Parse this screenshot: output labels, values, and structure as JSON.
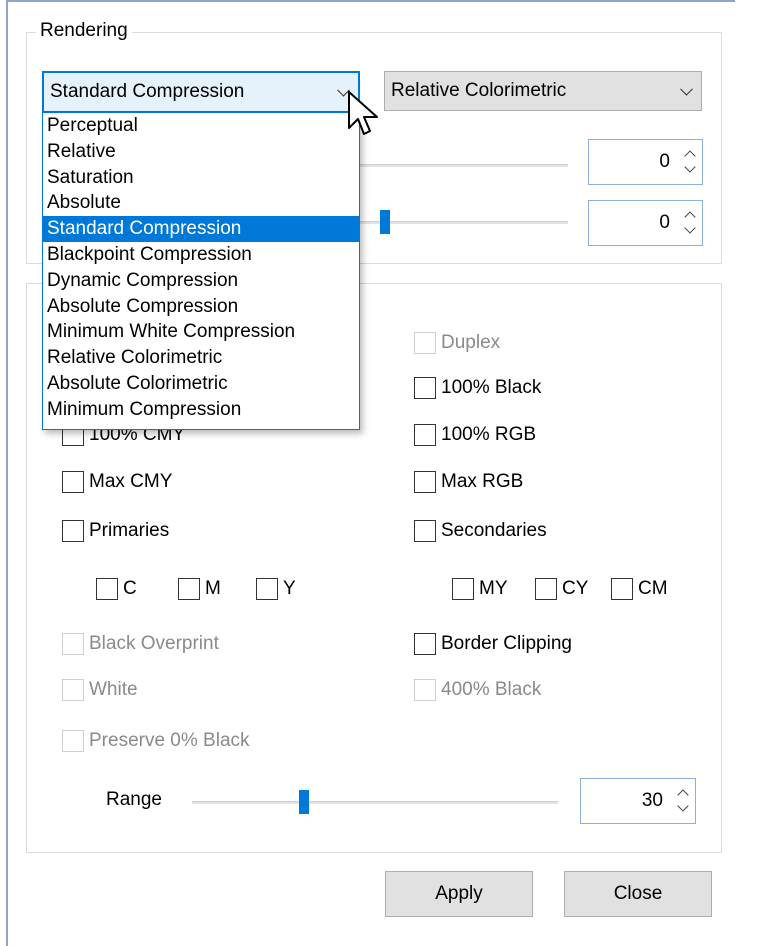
{
  "rendering": {
    "group_label": "Rendering",
    "intent_combo": {
      "value": "Standard Compression",
      "icon": "chevron-down-icon"
    },
    "method_combo": {
      "value": "Relative Colorimetric",
      "icon": "chevron-down-icon"
    },
    "dropdown_items": [
      "Perceptual",
      "Relative",
      "Saturation",
      "Absolute",
      "Standard Compression",
      "Blackpoint Compression",
      "Dynamic Compression",
      "Absolute Compression",
      "Minimum White Compression",
      "Relative Colorimetric",
      "Absolute Colorimetric",
      "Minimum Compression"
    ],
    "selected_item": "Standard Compression",
    "spin_1": {
      "value": "0"
    },
    "spin_2": {
      "value": "0"
    }
  },
  "options": {
    "checkboxes": {
      "duplex": "Duplex",
      "black_100": "100% Black",
      "cmy_100": "100% CMY",
      "rgb_100": "100% RGB",
      "max_cmy": "Max CMY",
      "max_rgb": "Max RGB",
      "primaries": "Primaries",
      "secondaries": "Secondaries",
      "c": "C",
      "m": "M",
      "y": "Y",
      "my": "MY",
      "cy": "CY",
      "cm": "CM",
      "black_overprint": "Black Overprint",
      "border_clipping": "Border Clipping",
      "white": "White",
      "black_400": "400% Black",
      "preserve_0_black": "Preserve 0% Black"
    },
    "range": {
      "label": "Range",
      "value": "30"
    }
  },
  "buttons": {
    "apply": "Apply",
    "close": "Close"
  },
  "colors": {
    "accent": "#0078d7",
    "disabled_text": "#8a8a8a"
  }
}
